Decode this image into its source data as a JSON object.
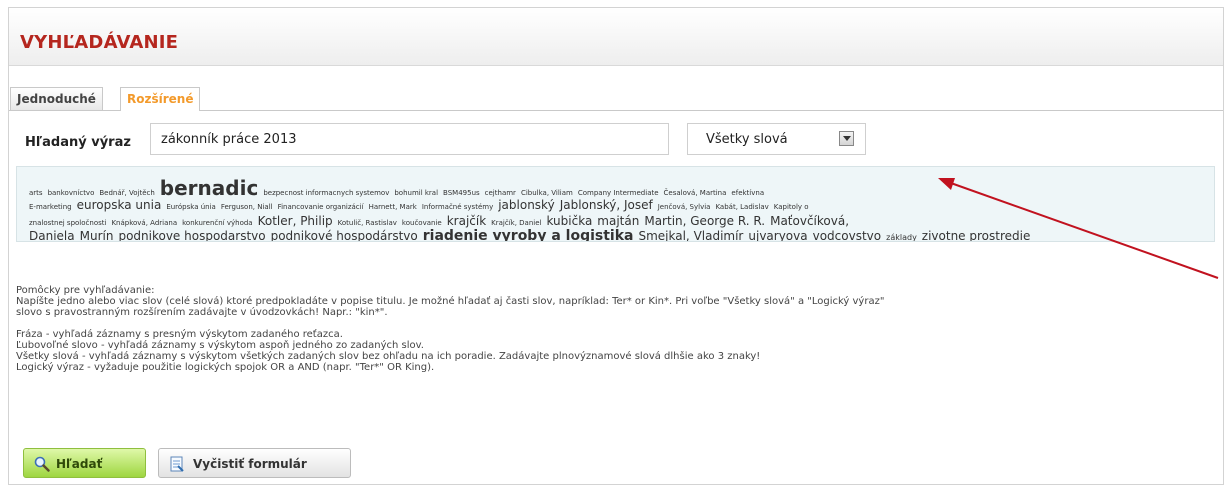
{
  "page_title": "VYHĽADÁVANIE",
  "tabs": [
    {
      "label": "Jednoduché"
    },
    {
      "label": "Rozšírené"
    }
  ],
  "search": {
    "label": "Hľadaný výraz",
    "value": "zákonník práce 2013",
    "mode": "Všetky slová"
  },
  "tagcloud": {
    "lines": [
      [
        {
          "text": "arts",
          "size": 1
        },
        {
          "text": "bankovníctvo",
          "size": 1
        },
        {
          "text": "Bednář, Vojtěch",
          "size": 1
        },
        {
          "text": "bernadic",
          "size": 5
        },
        {
          "text": "bezpecnost informacnych systemov",
          "size": 1
        },
        {
          "text": "bohumil kral",
          "size": 1
        },
        {
          "text": "BSM495us",
          "size": 1
        },
        {
          "text": "cejthamr",
          "size": 1
        },
        {
          "text": "Cibulka, Viliam",
          "size": 1
        },
        {
          "text": "Company Intermediate",
          "size": 1
        },
        {
          "text": "Česalová, Martina",
          "size": 1
        },
        {
          "text": "efektívna",
          "size": 1
        }
      ],
      [
        {
          "text": "E-marketing",
          "size": 1
        },
        {
          "text": "europska unia",
          "size": 3
        },
        {
          "text": "Európska únia",
          "size": 1
        },
        {
          "text": "Ferguson, Niall",
          "size": 1
        },
        {
          "text": "Financovanie organizácií",
          "size": 1
        },
        {
          "text": "Harnett, Mark",
          "size": 1
        },
        {
          "text": "Informačné systémy",
          "size": 1
        },
        {
          "text": "jablonský",
          "size": 3
        },
        {
          "text": "Jablonský, Josef",
          "size": 3
        },
        {
          "text": "Jenčová, Sylvia",
          "size": 1
        },
        {
          "text": "Kabát, Ladislav",
          "size": 1
        },
        {
          "text": "Kapitoly o",
          "size": 1
        }
      ],
      [
        {
          "text": "znalostnej spoločnosti",
          "size": 1
        },
        {
          "text": "Knápková, Adriana",
          "size": 1
        },
        {
          "text": "konkurenční výhoda",
          "size": 1
        },
        {
          "text": "Kotler, Philip",
          "size": 3
        },
        {
          "text": "Kotulič, Rastislav",
          "size": 1
        },
        {
          "text": "koučovanie",
          "size": 1
        },
        {
          "text": "krajčík",
          "size": 3
        },
        {
          "text": "Krajčík, Daniel",
          "size": 1
        },
        {
          "text": "kubička",
          "size": 3
        },
        {
          "text": "majtán",
          "size": 3
        },
        {
          "text": "Martin, George R. R.",
          "size": 3
        },
        {
          "text": "Maťovčíková,",
          "size": 3
        }
      ],
      [
        {
          "text": "Daniela",
          "size": 3
        },
        {
          "text": "Murín",
          "size": 3
        },
        {
          "text": "podnikove hospodarstvo",
          "size": 3
        },
        {
          "text": "podnikové hospodárstvo",
          "size": 3
        },
        {
          "text": "riadenie vyroby a logistika",
          "size": 4
        },
        {
          "text": "Smejkal, Vladimír",
          "size": 3
        },
        {
          "text": "ujvaryova",
          "size": 3
        },
        {
          "text": "vodcovstvo",
          "size": 3
        },
        {
          "text": "základy",
          "size": 2
        },
        {
          "text": "zivotne prostredie",
          "size": 3
        }
      ]
    ]
  },
  "help": {
    "title": "Pomôcky pre vyhľadávanie:",
    "intro_1": "Napíšte jedno alebo viac slov (celé slová) ktoré predpokladáte v popise titulu. Je možné hľadať aj časti slov, napríklad: Ter* or Kin*. Pri voľbe \"Všetky slová\" a \"Logický výraz\"",
    "intro_2": "slovo s pravostranným rozšírením zadávajte v úvodzovkách! Napr.: \"kin*\".",
    "line_fraza": "Fráza - vyhľadá záznamy s presným výskytom zadaného reťazca.",
    "line_lubovolne": "Ľubovoľné slovo - vyhľadá záznamy s výskytom aspoň jedného zo zadaných slov.",
    "line_vsetky": "Všetky slová - vyhľadá záznamy s výskytom všetkých zadaných slov bez ohľadu na ich poradie. Zadávajte plnovýznamové slová dlhšie ako 3 znaky!",
    "line_logicky": "Logický výraz - vyžaduje použitie logických spojok OR a AND (napr. \"Ter*\" OR King)."
  },
  "buttons": {
    "search": "Hľadať",
    "clear": "Vyčistiť formulár"
  },
  "colors": {
    "title": "#b5261e",
    "active_tab": "#f39a2b",
    "arrow": "#c1121f",
    "tagcloud_bg": "#eef6f8",
    "search_button": "#9ed640"
  }
}
